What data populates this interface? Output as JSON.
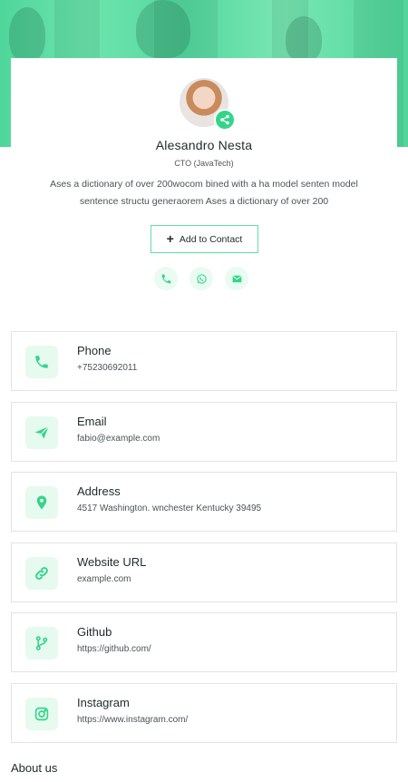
{
  "profile": {
    "name": "Alesandro Nesta",
    "role": "CTO (JavaTech)",
    "bio": "Ases a dictionary of over 200wocom bined with a ha model senten model sentence structu generaorem Ases a dictionary of over 200",
    "add_contact_label": "Add to Contact"
  },
  "quick_actions": [
    "phone-icon",
    "whatsapp-icon",
    "email-icon"
  ],
  "contacts": [
    {
      "icon": "phone-icon",
      "label": "Phone",
      "value": "+75230692011"
    },
    {
      "icon": "paper-plane-icon",
      "label": "Email",
      "value": "fabio@example.com"
    },
    {
      "icon": "location-pin-icon",
      "label": "Address",
      "value": "4517 Washington. wnchester Kentucky 39495"
    },
    {
      "icon": "link-icon",
      "label": "Website URL",
      "value": "example.com"
    },
    {
      "icon": "git-branch-icon",
      "label": "Github",
      "value": "https://github.com/"
    },
    {
      "icon": "instagram-icon",
      "label": "Instagram",
      "value": "https://www.instagram.com/"
    }
  ],
  "about": {
    "heading": "About us"
  },
  "colors": {
    "accent": "#34d58b",
    "hero": "#5fdea6",
    "icon_bg": "#e6faf0"
  }
}
